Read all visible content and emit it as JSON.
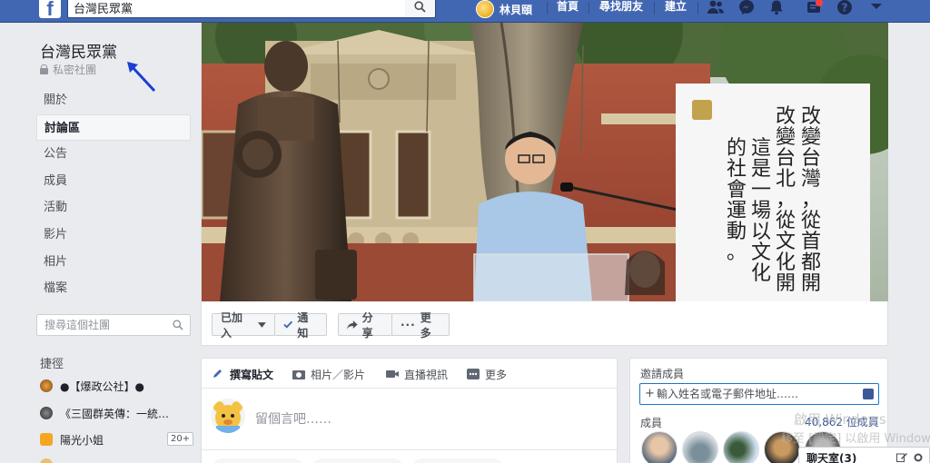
{
  "topbar": {
    "search_value": "台灣民眾黨",
    "user_name": "林貝頤",
    "links": [
      "首頁",
      "尋找朋友",
      "建立"
    ]
  },
  "group": {
    "name": "台灣民眾黨",
    "privacy": "私密社團"
  },
  "sidebar": {
    "items": [
      {
        "label": "關於"
      },
      {
        "label": "討論區"
      },
      {
        "label": "公告"
      },
      {
        "label": "成員"
      },
      {
        "label": "活動"
      },
      {
        "label": "影片"
      },
      {
        "label": "相片"
      },
      {
        "label": "檔案"
      }
    ],
    "search_placeholder": "搜尋這個社團",
    "shortcuts_title": "捷徑",
    "shortcuts": [
      {
        "label": "●【爆政公社】●"
      },
      {
        "label": "《三國群英傳：一統…"
      },
      {
        "label": "陽光小姐",
        "count": "20+"
      },
      {
        "label": ""
      }
    ]
  },
  "cover": {
    "banner_lines": [
      "改變台灣，從首都開",
      "改變台北，從文化開",
      "這是一場以文化",
      "的社會運動。"
    ]
  },
  "actions": {
    "joined": "已加入",
    "notify": "通知",
    "share": "分享",
    "more": "更多"
  },
  "composer": {
    "tabs": [
      "撰寫貼文",
      "相片／影片",
      "直播視訊",
      "更多"
    ],
    "placeholder": "留個言吧……"
  },
  "invite": {
    "title": "邀請成員",
    "input_placeholder": "輸入姓名或電子郵件地址……",
    "members_label": "成員",
    "members_count": "40,862 位成員"
  },
  "chat": {
    "label": "聊天室(3)"
  },
  "watermark": {
    "line1": "啟用 Windows",
    "line2": "移至 [設定] 以啟用 Windows"
  },
  "colors": {
    "brand": "#4267b2",
    "link": "#385898",
    "annotation_arrow": "#1a3fd6"
  }
}
